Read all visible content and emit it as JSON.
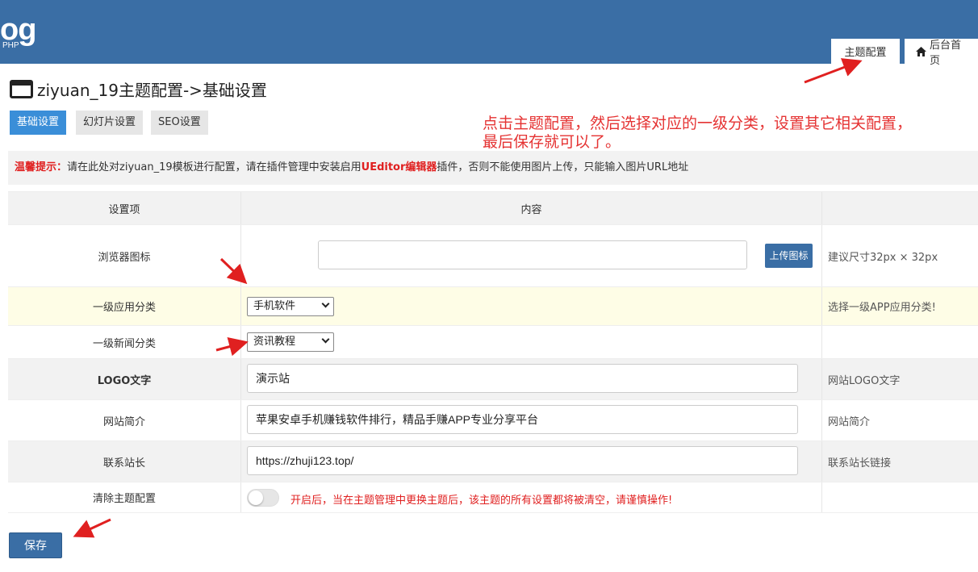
{
  "header": {
    "logo_text": "og",
    "logo_sub": "PHP",
    "tabs": [
      {
        "label": "主题配置"
      },
      {
        "label": "后台首页",
        "icon": "home-icon"
      }
    ]
  },
  "page_title": "ziyuan_19主题配置->基础设置",
  "subtabs": [
    {
      "label": "基础设置",
      "active": true
    },
    {
      "label": "幻灯片设置"
    },
    {
      "label": "SEO设置"
    }
  ],
  "annotation": "点击主题配置，然后选择对应的一级分类，设置其它相关配置，最后保存就可以了。",
  "notice": {
    "prefix": "温馨提示：",
    "text1": "请在此处对ziyuan_19模板进行配置，请在插件管理中安装启用",
    "highlight": "UEditor编辑器",
    "text2": "插件，否则不能使用图片上传，只能输入图片URL地址"
  },
  "table": {
    "headers": [
      "设置项",
      "内容"
    ],
    "rows": {
      "favicon": {
        "label": "浏览器图标",
        "value": "",
        "button": "上传图标",
        "hint": "建议尺寸32px × 32px"
      },
      "app_category": {
        "label": "一级应用分类",
        "selected": "手机软件",
        "hint": "选择一级APP应用分类!"
      },
      "news_category": {
        "label": "一级新闻分类",
        "selected": "资讯教程",
        "hint": ""
      },
      "logo_text": {
        "label": "LOGO文字",
        "value": "演示站",
        "hint": "网站LOGO文字"
      },
      "site_intro": {
        "label": "网站简介",
        "value": "苹果安卓手机赚钱软件排行，精品手赚APP专业分享平台",
        "hint": "网站简介"
      },
      "contact": {
        "label": "联系站长",
        "value": "https://zhuji123.top/",
        "hint": "联系站长链接"
      },
      "clear_config": {
        "label": "清除主题配置",
        "toggle_on": false,
        "warning": "开启后，当在主题管理中更换主题后，该主题的所有设置都将被清空，请谨慎操作!"
      }
    }
  },
  "save_label": "保存",
  "colors": {
    "header_bg": "#3a6ea5",
    "accent": "#3a8ed8",
    "warning": "#e02020",
    "arrow": "#e02020"
  }
}
